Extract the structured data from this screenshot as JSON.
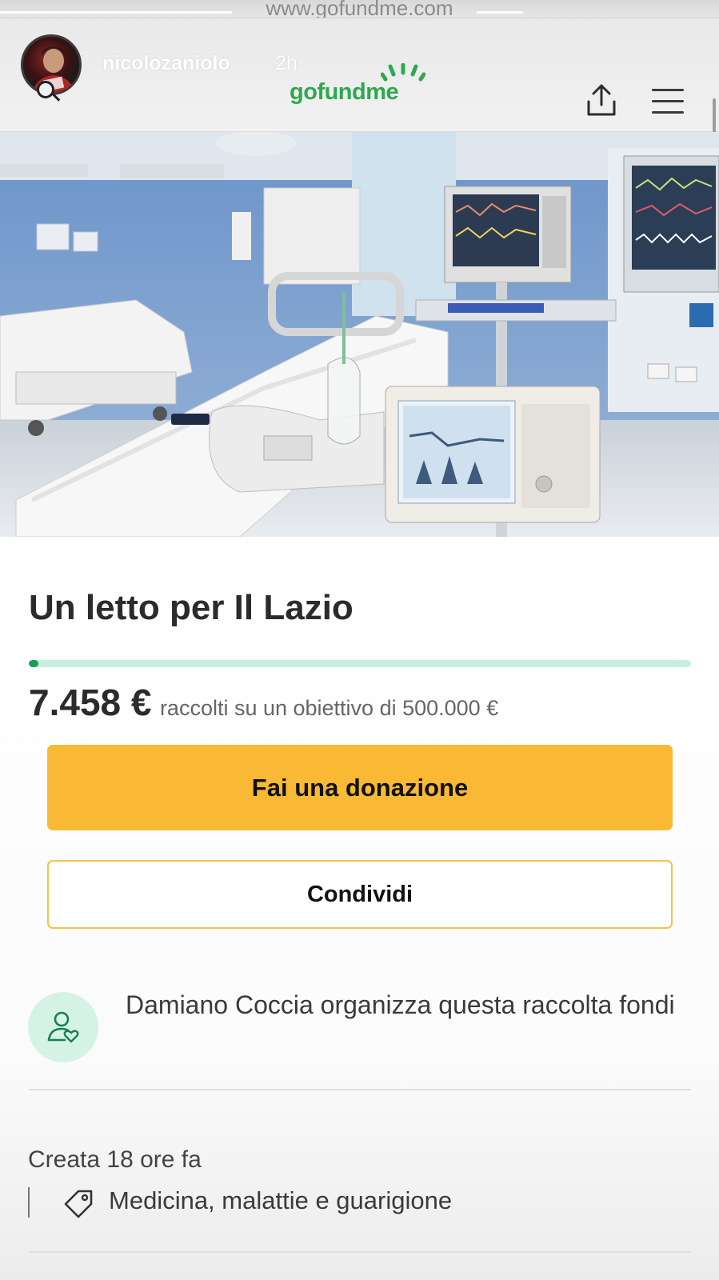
{
  "url": "www.gofundme.com",
  "story": {
    "username": "nicolozaniolo",
    "time_ago": "2h"
  },
  "brand": {
    "logo_text": "gofundme",
    "color": "#2fa84f"
  },
  "hero": {
    "image_icon": "hospital-icu-photo"
  },
  "campaign": {
    "title": "Un letto per Il Lazio",
    "progress_fraction": 0.015,
    "raised": "7.458 €",
    "raised_suffix": "raccolti su un obiettivo di 500.000 €",
    "donate_label": "Fai una donazione",
    "share_label": "Condividi",
    "organizer_text": "Damiano Coccia organizza questa raccolta fondi",
    "created": "Creata 18 ore fa",
    "category": "Medicina, malattie e guarigione"
  },
  "colors": {
    "donate_button": "#f9b934",
    "share_border": "#f4c24a",
    "progress_fill": "#1a9d5c",
    "progress_track": "#c8eedd",
    "organizer_icon_bg": "#d5f3e5"
  },
  "icons": {
    "share": "share-icon",
    "menu": "hamburger-menu-icon",
    "organizer": "user-heart-icon",
    "category": "tag-icon"
  }
}
